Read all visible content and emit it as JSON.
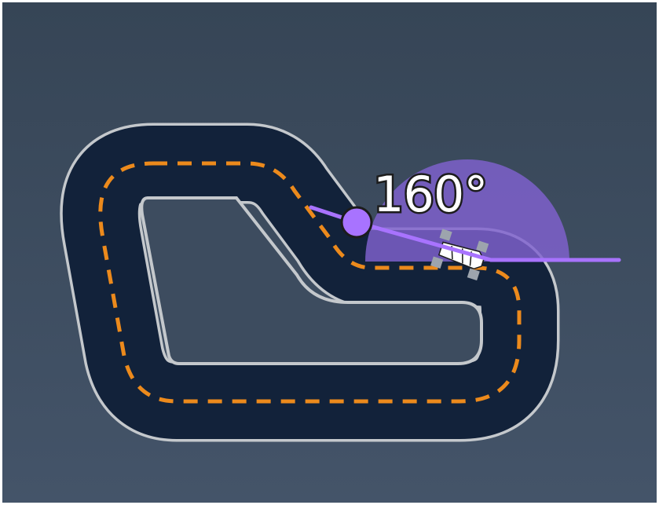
{
  "heading_readout": {
    "label": "160°",
    "value_degrees": 160
  },
  "colors": {
    "background_top": "#364556",
    "background_bottom": "#445469",
    "track_surface": "#12223a",
    "track_border": "#c4c8cc",
    "centerline_dash": "#ec8a1c",
    "heading_accent": "#a873ff",
    "heading_fill": "#7d5ec2",
    "car_body": "#ffffff",
    "car_wheels": "#9da4ad"
  },
  "icons": {
    "waypoint": "waypoint-marker-icon",
    "car": "race-car-icon"
  }
}
